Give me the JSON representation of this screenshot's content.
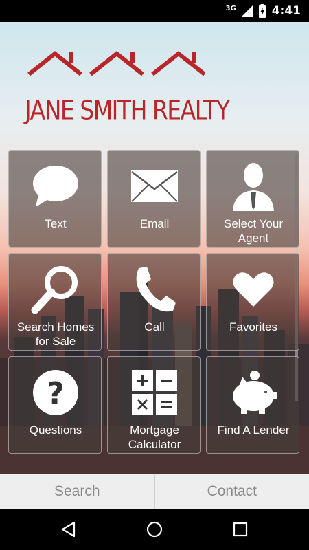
{
  "status": {
    "network": "3G",
    "time": "4:41"
  },
  "brand": {
    "name": "JANE SMITH REALTY",
    "color": "#b8262a"
  },
  "tiles": [
    {
      "label": "Text",
      "icon": "speech-bubble-icon"
    },
    {
      "label": "Email",
      "icon": "envelope-icon"
    },
    {
      "label": "Select Your Agent",
      "icon": "agent-person-icon"
    },
    {
      "label": "Search Homes for Sale",
      "icon": "magnifier-icon"
    },
    {
      "label": "Call",
      "icon": "phone-icon"
    },
    {
      "label": "Favorites",
      "icon": "heart-icon"
    },
    {
      "label": "Questions",
      "icon": "question-mark-icon"
    },
    {
      "label": "Mortgage Calculator",
      "icon": "calculator-icon"
    },
    {
      "label": "Find A Lender",
      "icon": "piggy-bank-icon"
    }
  ],
  "bottom": {
    "search": "Search",
    "contact": "Contact"
  },
  "nav": {
    "back": "back-icon",
    "home": "home-icon",
    "recents": "recents-icon"
  }
}
